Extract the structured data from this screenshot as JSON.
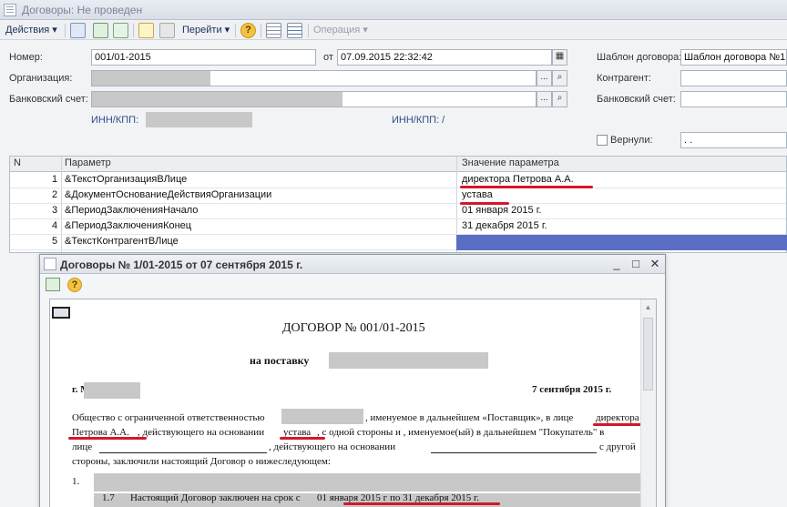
{
  "window": {
    "title": "Договоры: Не проведен"
  },
  "toolbar": {
    "actions_label": "Действия",
    "goto_label": "Перейти",
    "operation_label": "Операция"
  },
  "form": {
    "number_label": "Номер:",
    "number_value": "001/01-2015",
    "date_label": "от",
    "date_value": "07.09.2015 22:32:42",
    "org_label": "Организация:",
    "bank_label": "Банковский счет:",
    "inn_label": "ИНН/КПП:",
    "inn2_label": "ИНН/КПП: /",
    "template_label": "Шаблон договора:",
    "template_value": "Шаблон договора №1",
    "counterparty_label": "Контрагент:",
    "bank2_label": "Банковский счет:",
    "returned_label": "Вернули:",
    "returned_value": " . ."
  },
  "table": {
    "headers": [
      "N",
      "Параметр",
      "Значение параметра"
    ],
    "rows": [
      {
        "n": "1",
        "param": "&ТекстОрганизацияВЛице",
        "value": "директора Петрова А.А."
      },
      {
        "n": "2",
        "param": "&ДокументОснованиеДействияОрганизации",
        "value": "устава"
      },
      {
        "n": "3",
        "param": "&ПериодЗаключенияНачало",
        "value": "01 января 2015 г."
      },
      {
        "n": "4",
        "param": "&ПериодЗаключенияКонец",
        "value": "31 декабря 2015 г."
      },
      {
        "n": "5",
        "param": "&ТекстКонтрагентВЛице",
        "value": ""
      }
    ]
  },
  "inner": {
    "title": "Договоры № 1/01-2015 от 07 сентября 2015 г.",
    "doc": {
      "heading": "ДОГОВОР № 001/01-2015",
      "subheading": "на поставку",
      "city": "г. М",
      "date": "7 сентября 2015 г.",
      "p1_a": "Общество с ограниченной ответственностью",
      "p1_b": ", именуемое в дальнейшем «Поставщик», в лице",
      "p1_c": "директора",
      "p2_a": "Петрова А.А.",
      "p2_b": ", действующего на основании",
      "p2_c": "устава",
      "p2_d": ", с одной стороны и , именуемое(ый) в дальнейшем \"Покупатель\" в",
      "p3_a": "лице",
      "p3_b": ", действующего на основании",
      "p3_c": "с другой",
      "p4": "стороны, заключили настоящий Договор о нижеследующем:",
      "item1": "1.",
      "item17_num": "1.7",
      "item17_text": "Настоящий Договор заключен на срок с",
      "item17_period": "01 января 2015 г по 31 декабря 2015 г."
    }
  }
}
